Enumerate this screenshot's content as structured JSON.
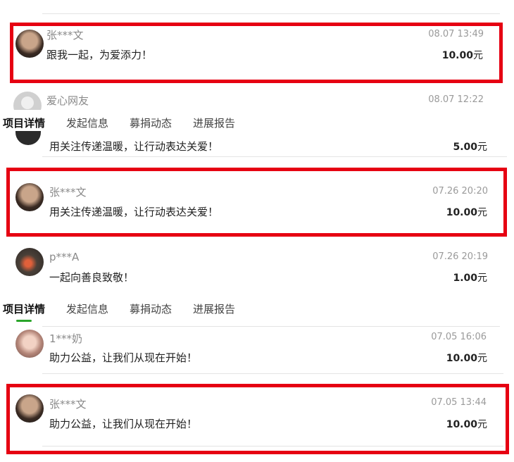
{
  "currency_unit": "元",
  "tabs": [
    "项目详情",
    "发起信息",
    "募捐动态",
    "进展报告"
  ],
  "donations": [
    {
      "name": "张***文",
      "time": "08.07 13:49",
      "message": "跟我一起，为爱添力！",
      "amount": "10.00",
      "highlighted": true
    },
    {
      "name": "爱心网友",
      "time": "08.07 12:22",
      "message": "",
      "amount": "",
      "highlighted": false
    },
    {
      "name": "",
      "time": "",
      "message": "用关注传递温暖，让行动表达关爱！",
      "amount": "5.00",
      "highlighted": false
    },
    {
      "name": "张***文",
      "time": "07.26 20:20",
      "message": "用关注传递温暖，让行动表达关爱！",
      "amount": "10.00",
      "highlighted": true
    },
    {
      "name": "p***A",
      "time": "07.26 20:19",
      "message": "一起向善良致敬！",
      "amount": "1.00",
      "highlighted": false
    },
    {
      "name": "1***奶",
      "time": "07.05 16:06",
      "message": "助力公益，让我们从现在开始！",
      "amount": "10.00",
      "highlighted": false
    },
    {
      "name": "张***文",
      "time": "07.05 13:44",
      "message": "助力公益，让我们从现在开始！",
      "amount": "10.00",
      "highlighted": true
    }
  ],
  "colors": {
    "highlight": "#e60012",
    "tab_indicator": "#2aa52a"
  }
}
